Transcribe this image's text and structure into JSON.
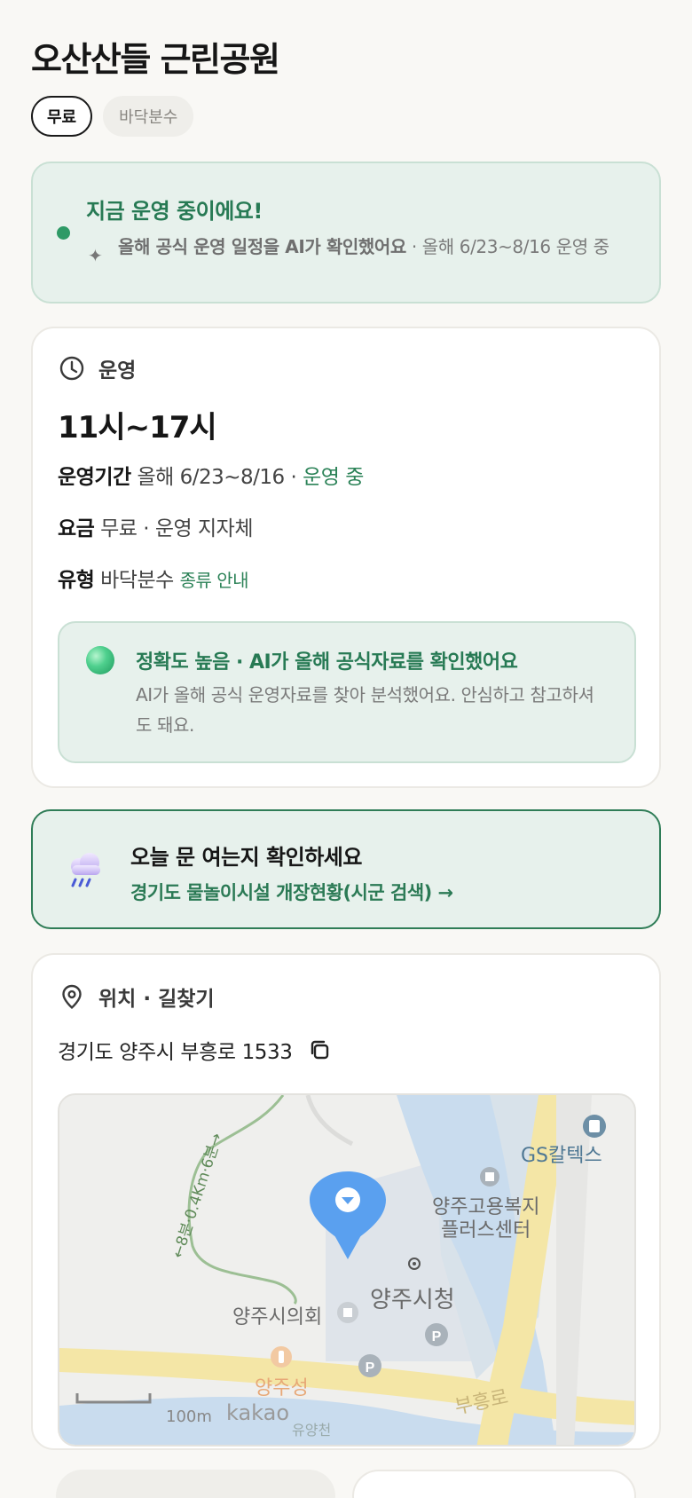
{
  "title": "오산산들 근린공원",
  "chips": [
    "무료",
    "바닥분수"
  ],
  "status": {
    "title": "지금 운영 중이에요!",
    "sub_strong": "올해 공식 운영 일정을 AI가 확인했어요",
    "sub_rest": " · 올해 6/23~8/16 운영 중"
  },
  "operation": {
    "header": "운영",
    "hours": "11시~17시",
    "period_label": "운영기간",
    "period_value": "올해 6/23~8/16 · ",
    "period_status": "운영 중",
    "fee_label": "요금",
    "fee_value": "무료 · 운영 지자체",
    "type_label": "유형",
    "type_value": "바닥분수",
    "type_link": "종류 안내",
    "accuracy_title": "정확도 높음 · AI가 올해 공식자료를 확인했어요",
    "accuracy_text": "AI가 올해 공식 운영자료를 찾아 분석했어요. 안심하고 참고하셔도 돼요."
  },
  "check": {
    "title": "오늘 문 여는지 확인하세요",
    "link": "경기도 물놀이시설 개장현황(시군 검색) →"
  },
  "location": {
    "header": "위치 · 길찾기",
    "address": "경기도 양주시 부흥로 1533",
    "map_labels": {
      "gs": "GS칼텍스",
      "welfare_line1": "양주고용복지",
      "welfare_line2": "플러스센터",
      "city_hall": "양주시청",
      "council": "양주시의회",
      "restaurant": "양주성",
      "road": "부흥로",
      "trail": "←8분·0.4Km·6분→",
      "scale": "100m",
      "brand": "kakao",
      "stream": "유양천"
    }
  },
  "colors": {
    "accent_green": "#2b8257",
    "status_bg": "#e7f1ec",
    "page_bg": "#f9f8f5"
  }
}
